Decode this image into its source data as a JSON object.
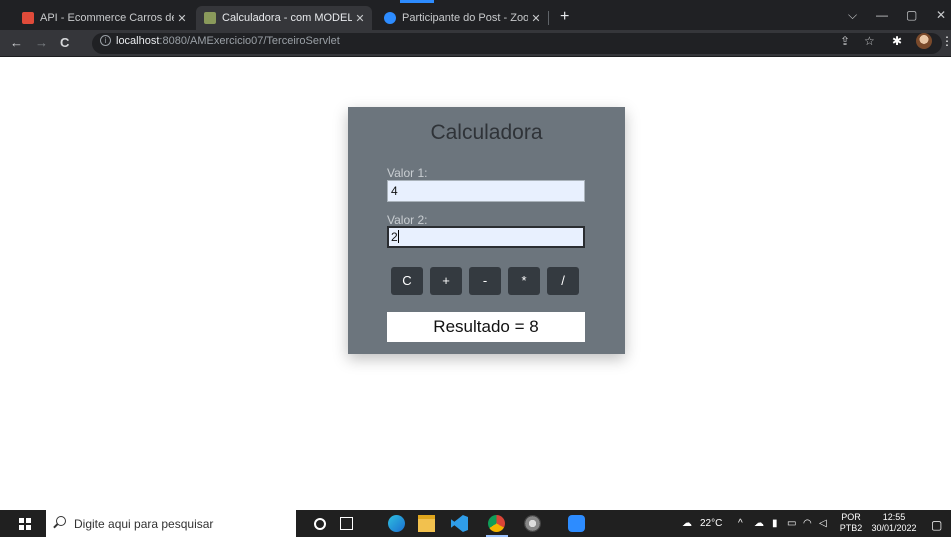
{
  "browser": {
    "tabs": [
      {
        "title": "API - Ecommerce Carros de Luxo",
        "favicon_color": "#e04b3a",
        "active": false
      },
      {
        "title": "Calculadora - com MODEL",
        "favicon_color": "#8a9a5b",
        "active": true
      },
      {
        "title": "Participante do Post - Zoom",
        "favicon_color": "#2d8cff",
        "active": false
      }
    ],
    "new_tab_icon": "+",
    "close_icon": "✕",
    "url_host": "localhost",
    "url_rest": ":8080/AMExercicio07/TerceiroServlet",
    "nav_icons": {
      "back": "←",
      "forward": "→",
      "reload": "C"
    },
    "window_controls": {
      "dropdown": "⌵",
      "minimize": "—",
      "restore": "▢",
      "close": "✕"
    }
  },
  "calculator": {
    "title": "Calculadora",
    "valor1_label": "Valor 1:",
    "valor1_value": "4",
    "valor2_label": "Valor 2:",
    "valor2_value": "2",
    "buttons": [
      "C",
      "+",
      "-",
      "*",
      "/"
    ],
    "result": "Resultado = 8"
  },
  "taskbar": {
    "search_placeholder": "Digite aqui para pesquisar",
    "weather": "22°C",
    "language": "POR",
    "layout": "PTB2",
    "time": "12:55",
    "date": "30/01/2022"
  }
}
